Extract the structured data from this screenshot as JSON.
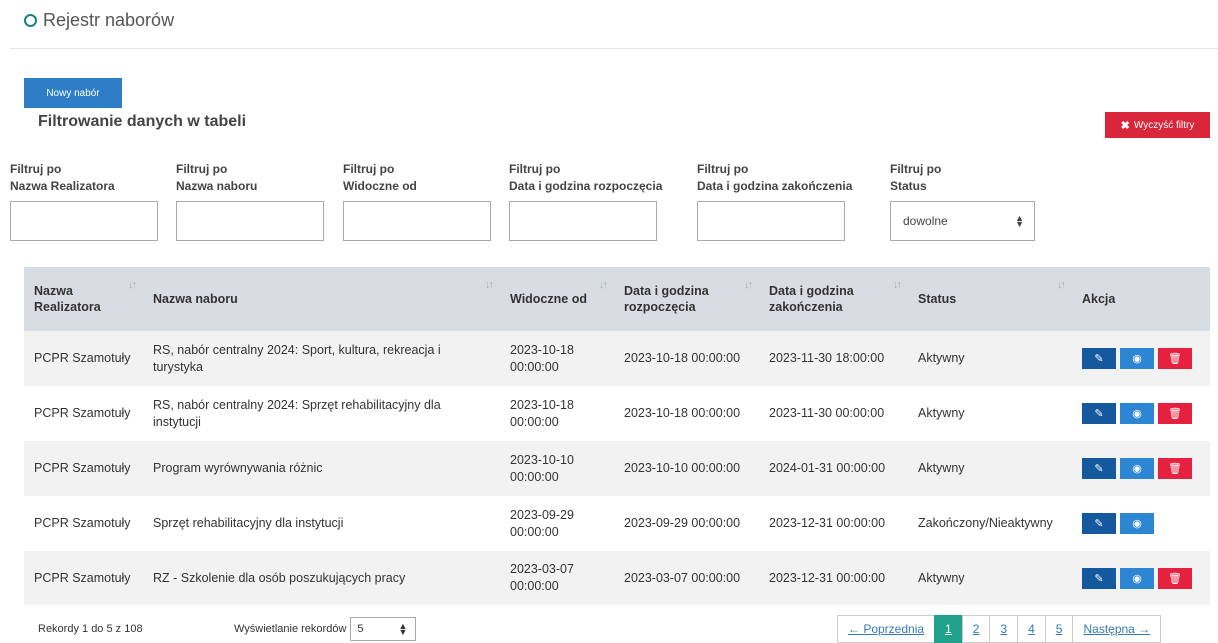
{
  "header": {
    "title": "Rejestr naborów"
  },
  "buttons": {
    "new": "Nowy nabór",
    "clear": "Wyczyść filtry",
    "clear_icon": "✖"
  },
  "filter_heading": "Filtrowanie danych w tabeli",
  "filters": [
    {
      "line1": "Filtruj po",
      "line2": "Nazwa Realizatora",
      "value": ""
    },
    {
      "line1": "Filtruj po",
      "line2": "Nazwa naboru",
      "value": ""
    },
    {
      "line1": "Filtruj po",
      "line2": "Widoczne od",
      "value": ""
    },
    {
      "line1": "Filtruj po",
      "line2": "Data i godzina rozpoczęcia",
      "value": ""
    },
    {
      "line1": "Filtruj po",
      "line2": "Data i godzina zakończenia",
      "value": ""
    },
    {
      "line1": "Filtruj po",
      "line2": "Status",
      "value": "dowolne"
    }
  ],
  "table": {
    "columns": [
      "Nazwa Realizatora",
      "Nazwa naboru",
      "Widoczne od",
      "Data i godzina rozpoczęcia",
      "Data i godzina zakończenia",
      "Status",
      "Akcja"
    ],
    "rows": [
      {
        "realizator": "PCPR Szamotuły",
        "nabor": "RS, nabór centralny 2024: Sport, kultura, rekreacja i turystyka",
        "widoczne": "2023-10-18 00:00:00",
        "start": "2023-10-18 00:00:00",
        "end": "2023-11-30 18:00:00",
        "status": "Aktywny",
        "deletable": true
      },
      {
        "realizator": "PCPR Szamotuły",
        "nabor": "RS, nabór centralny 2024: Sprzęt rehabilitacyjny dla instytucji",
        "widoczne": "2023-10-18 00:00:00",
        "start": "2023-10-18 00:00:00",
        "end": "2023-11-30 00:00:00",
        "status": "Aktywny",
        "deletable": true
      },
      {
        "realizator": "PCPR Szamotuły",
        "nabor": "Program wyrównywania różnic",
        "widoczne": "2023-10-10 00:00:00",
        "start": "2023-10-10 00:00:00",
        "end": "2024-01-31 00:00:00",
        "status": "Aktywny",
        "deletable": true
      },
      {
        "realizator": "PCPR Szamotuły",
        "nabor": "Sprzęt rehabilitacyjny dla instytucji",
        "widoczne": "2023-09-29 00:00:00",
        "start": "2023-09-29 00:00:00",
        "end": "2023-12-31 00:00:00",
        "status": "Zakończony/Nieaktywny",
        "deletable": false
      },
      {
        "realizator": "PCPR Szamotuły",
        "nabor": "RZ - Szkolenie dla osób poszukujących pracy",
        "widoczne": "2023-03-07 00:00:00",
        "start": "2023-03-07 00:00:00",
        "end": "2023-12-31 00:00:00",
        "status": "Aktywny",
        "deletable": true
      }
    ]
  },
  "icons": {
    "edit": "pencil-icon",
    "view": "eye-icon",
    "delete": "trash-icon",
    "sort": "sort-icon",
    "header": "circle-icon"
  },
  "footer": {
    "records_info": "Rekordy 1 do 5 z 108",
    "page_size_label": "Wyświetlanie rekordów",
    "page_size_value": "5"
  },
  "pagination": {
    "prev": "← Poprzednia",
    "pages": [
      "1",
      "2",
      "3",
      "4",
      "5"
    ],
    "current": "1",
    "next": "Następna →"
  },
  "colors": {
    "primary": "#2d7ec6",
    "danger": "#d9263a",
    "accent": "#20a18c",
    "edit": "#14589e",
    "view": "#2d86d4",
    "delete": "#e5213f"
  }
}
